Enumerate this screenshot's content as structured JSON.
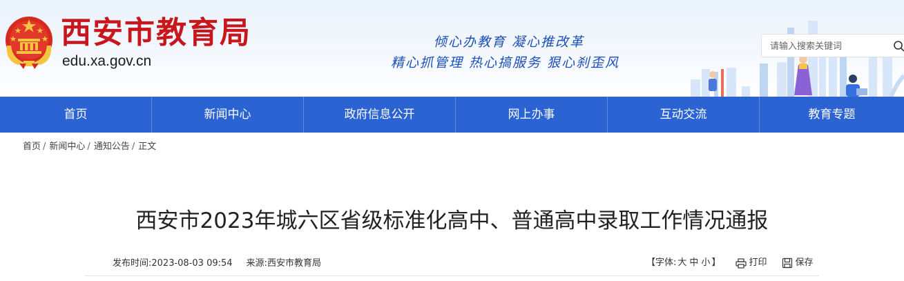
{
  "header": {
    "site_title": "西安市教育局",
    "site_domain": "edu.xa.gov.cn",
    "slogan_line1": "倾心办教育 凝心推改革",
    "slogan_line2": "精心抓管理 热心搞服务 狠心刹歪风",
    "search_placeholder": "请输入搜索关键词"
  },
  "nav": {
    "items": [
      "首页",
      "新闻中心",
      "政府信息公开",
      "网上办事",
      "互动交流",
      "教育专题"
    ]
  },
  "breadcrumb": {
    "items": [
      "首页",
      "新闻中心",
      "通知公告",
      "正文"
    ],
    "separator": "/"
  },
  "article": {
    "title": "西安市2023年城六区省级标准化高中、普通高中录取工作情况通报",
    "publish_label": "发布时间:",
    "publish_time": "2023-08-03 09:54",
    "source_label": "来源:",
    "source": "西安市教育局",
    "font_size_label": "【字体:",
    "font_large": "大",
    "font_medium": "中",
    "font_small": "小",
    "font_size_close": "】",
    "print_label": "打印",
    "save_label": "保存"
  },
  "colors": {
    "nav_bg": "#2c63d3",
    "title_red": "#c8161d",
    "slogan_blue": "#1a4fb8"
  }
}
